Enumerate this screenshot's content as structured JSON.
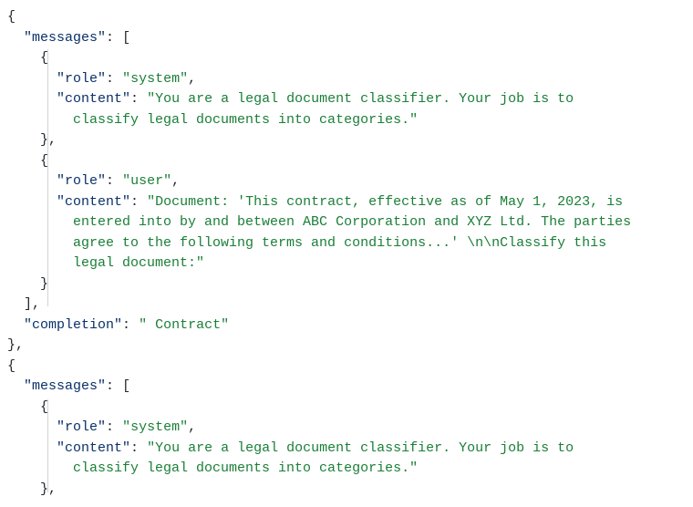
{
  "json_display": {
    "objects": [
      {
        "messages_key": "\"messages\"",
        "messages": [
          {
            "role_key": "\"role\"",
            "role_value": "\"system\"",
            "content_key": "\"content\"",
            "content_lines": [
              "\"You are a legal document classifier. Your job is to",
              "classify legal documents into categories.\""
            ]
          },
          {
            "role_key": "\"role\"",
            "role_value": "\"user\"",
            "content_key": "\"content\"",
            "content_lines": [
              "\"Document: 'This contract, effective as of May 1, 2023, is",
              "entered into by and between ABC Corporation and XYZ Ltd. The parties",
              "agree to the following terms and conditions...' \\n\\nClassify this",
              "legal document:\""
            ]
          }
        ],
        "completion_key": "\"completion\"",
        "completion_value": "\" Contract\""
      },
      {
        "messages_key": "\"messages\"",
        "messages": [
          {
            "role_key": "\"role\"",
            "role_value": "\"system\"",
            "content_key": "\"content\"",
            "content_lines": [
              "\"You are a legal document classifier. Your job is to",
              "classify legal documents into categories.\""
            ]
          }
        ]
      }
    ],
    "punct": {
      "open_brace": "{",
      "close_brace": "}",
      "open_bracket": "[",
      "close_bracket": "]",
      "colon": ":",
      "comma": ",",
      "close_brace_comma": "},",
      "close_bracket_comma": "],"
    }
  }
}
